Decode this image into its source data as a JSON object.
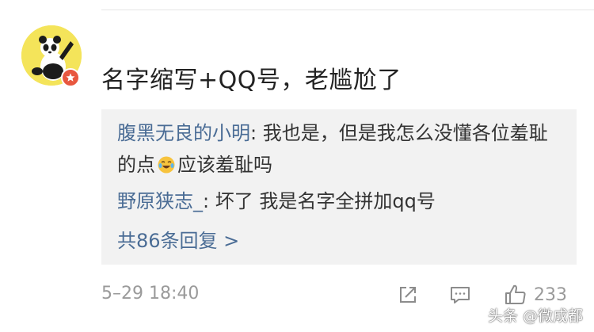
{
  "comment": {
    "text": "名字缩写+QQ号，老尴尬了",
    "timestamp": "5–29 18:40",
    "like_count": "233"
  },
  "replies": [
    {
      "author": "腹黑无良的小明",
      "separator": ": ",
      "text_part1": "我也是，但是我怎么没懂各位羞耻的点",
      "emoji": "laugh-cry-emoji",
      "text_part2": "应该羞耻吗"
    },
    {
      "author": "野原狭志_",
      "separator": ": ",
      "text": "坏了 我是名字全拼加qq号"
    }
  ],
  "more_replies_label": "共86条回复 >",
  "watermark": "头条 @微成都",
  "icons": {
    "share": "share-icon",
    "reply": "comment-icon",
    "like": "thumbs-up-icon",
    "badge": "verified-badge-icon"
  },
  "colors": {
    "author_link": "#4a6c95",
    "reply_box_bg": "#f2f2f2",
    "meta_text": "#9a9a9a",
    "badge": "#e8573f"
  }
}
